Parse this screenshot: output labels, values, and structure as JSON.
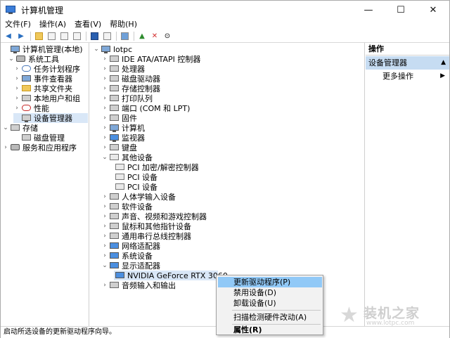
{
  "window": {
    "title": "计算机管理",
    "minimize": "—",
    "maximize": "☐",
    "close": "✕"
  },
  "menu": [
    "文件(F)",
    "操作(A)",
    "查看(V)",
    "帮助(H)"
  ],
  "left_tree": [
    {
      "label": "计算机管理(本地)",
      "icon": "computer-manage-icon",
      "expander": ""
    },
    {
      "label": "系统工具",
      "icon": "tools-icon",
      "expander": "⌄"
    },
    {
      "label": "任务计划程序",
      "icon": "clock-icon",
      "expander": "›"
    },
    {
      "label": "事件查看器",
      "icon": "event-viewer-icon",
      "expander": "›"
    },
    {
      "label": "共享文件夹",
      "icon": "folder-icon",
      "expander": "›"
    },
    {
      "label": "本地用户和组",
      "icon": "users-icon",
      "expander": "›"
    },
    {
      "label": "性能",
      "icon": "performance-icon",
      "expander": "›"
    },
    {
      "label": "设备管理器",
      "icon": "device-manager-icon",
      "expander": ""
    },
    {
      "label": "存储",
      "icon": "storage-icon",
      "expander": "⌄"
    },
    {
      "label": "磁盘管理",
      "icon": "disk-icon",
      "expander": ""
    },
    {
      "label": "服务和应用程序",
      "icon": "services-icon",
      "expander": "›"
    }
  ],
  "device_tree": [
    {
      "label": "lotpc",
      "icon": "computer-icon",
      "expander": "⌄"
    },
    {
      "label": "IDE ATA/ATAPI 控制器",
      "icon": "ide-icon",
      "expander": "›"
    },
    {
      "label": "处理器",
      "icon": "cpu-icon",
      "expander": "›"
    },
    {
      "label": "磁盘驱动器",
      "icon": "disk-drive-icon",
      "expander": "›"
    },
    {
      "label": "存储控制器",
      "icon": "storage-controller-icon",
      "expander": "›"
    },
    {
      "label": "打印队列",
      "icon": "printer-icon",
      "expander": "›"
    },
    {
      "label": "端口 (COM 和 LPT)",
      "icon": "port-icon",
      "expander": "›"
    },
    {
      "label": "固件",
      "icon": "firmware-icon",
      "expander": "›"
    },
    {
      "label": "计算机",
      "icon": "computer-icon",
      "expander": "›"
    },
    {
      "label": "监视器",
      "icon": "monitor-icon",
      "expander": "›"
    },
    {
      "label": "键盘",
      "icon": "keyboard-icon",
      "expander": "›"
    },
    {
      "label": "其他设备",
      "icon": "other-devices-icon",
      "expander": "⌄"
    },
    {
      "label": "PCI 加密/解密控制器",
      "icon": "unknown-device-warning-icon",
      "expander": ""
    },
    {
      "label": "PCI 设备",
      "icon": "unknown-device-warning-icon",
      "expander": ""
    },
    {
      "label": "PCI 设备",
      "icon": "unknown-device-warning-icon",
      "expander": ""
    },
    {
      "label": "人体学输入设备",
      "icon": "hid-icon",
      "expander": "›"
    },
    {
      "label": "软件设备",
      "icon": "software-device-icon",
      "expander": "›"
    },
    {
      "label": "声音、视频和游戏控制器",
      "icon": "sound-icon",
      "expander": "›"
    },
    {
      "label": "鼠标和其他指针设备",
      "icon": "mouse-icon",
      "expander": "›"
    },
    {
      "label": "通用串行总线控制器",
      "icon": "usb-icon",
      "expander": "›"
    },
    {
      "label": "网络适配器",
      "icon": "network-icon",
      "expander": "›"
    },
    {
      "label": "系统设备",
      "icon": "system-device-icon",
      "expander": "›"
    },
    {
      "label": "显示适配器",
      "icon": "display-adapter-icon",
      "expander": "⌄"
    },
    {
      "label": "NVIDIA GeForce RTX 3060",
      "icon": "display-adapter-icon",
      "expander": ""
    },
    {
      "label": "音频输入和输出",
      "icon": "audio-icon",
      "expander": "›"
    }
  ],
  "actions": {
    "header": "操作",
    "selected": "设备管理器",
    "more": "更多操作"
  },
  "context_menu": [
    "更新驱动程序(P)",
    "禁用设备(D)",
    "卸载设备(U)",
    "扫描检测硬件改动(A)",
    "属性(R)"
  ],
  "status": "启动所选设备的更新驱动程序向导。",
  "watermark": {
    "text": "装机之家",
    "url": "www.lotpc.com"
  },
  "colors": {
    "selection": "#d9e7f7",
    "context_highlight": "#91c9f7",
    "actions_selected": "#c6dcf2"
  }
}
